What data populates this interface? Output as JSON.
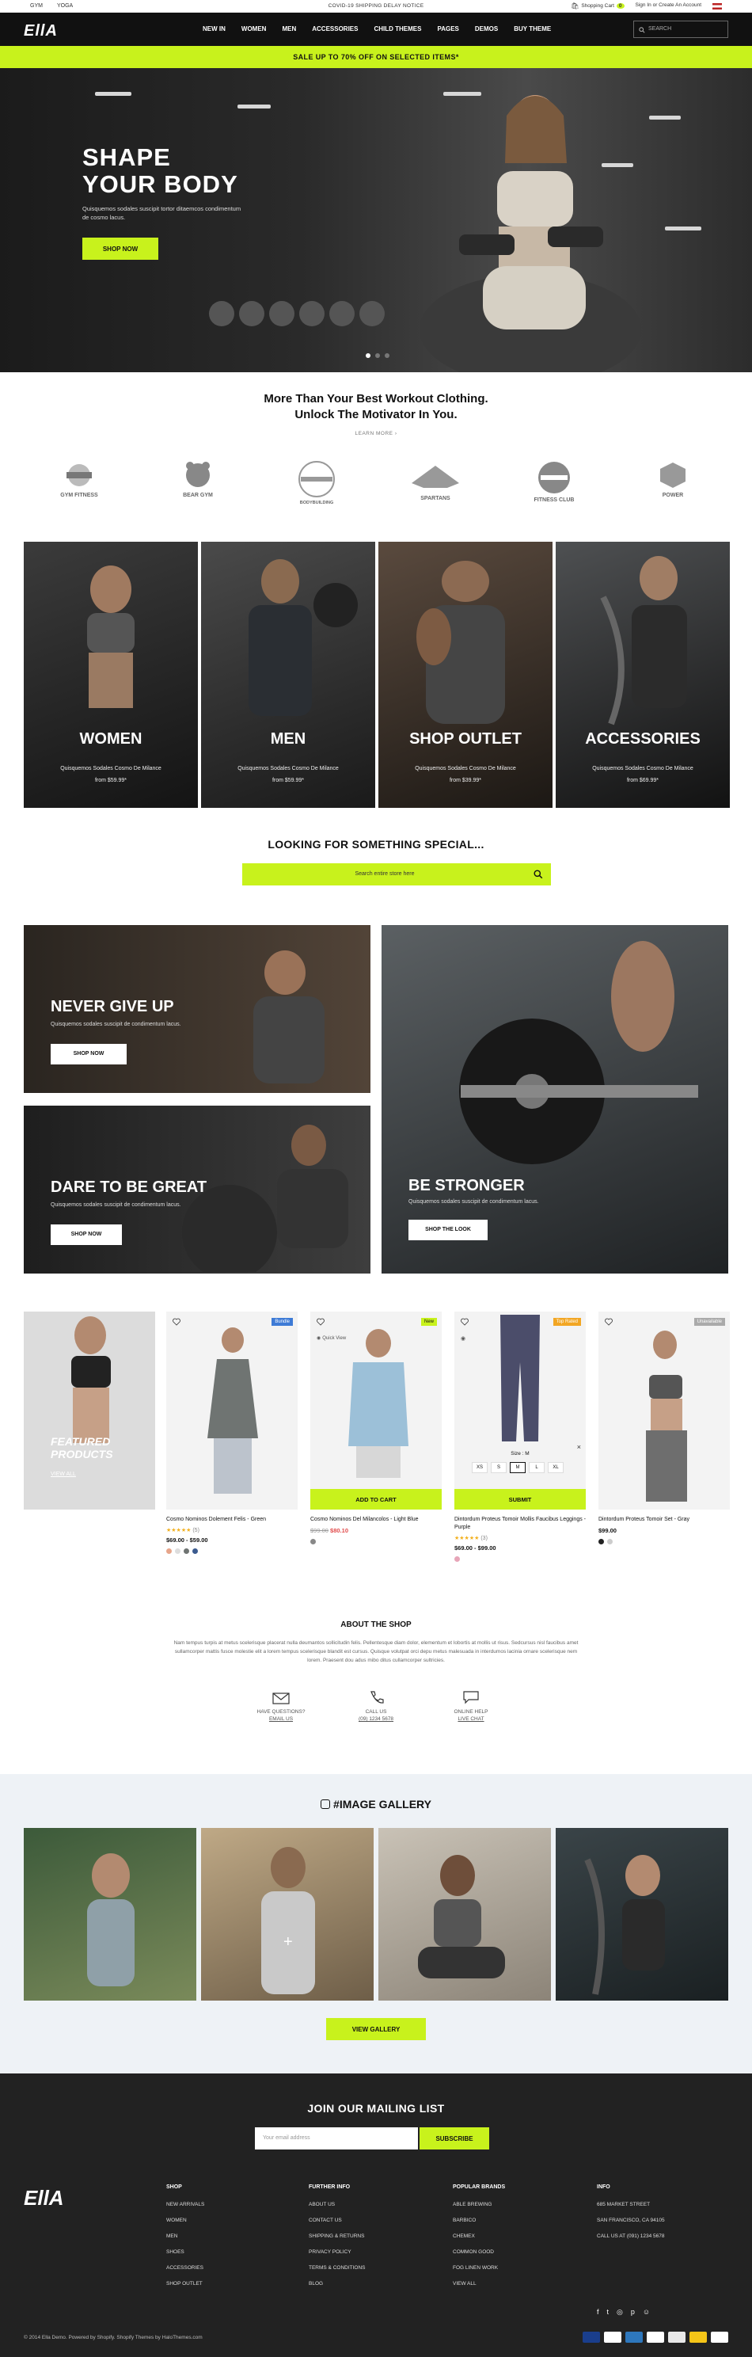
{
  "utility": {
    "links": [
      "GYM",
      "YOGA"
    ],
    "notice": "COVID-19 SHIPPING DELAY NOTICE",
    "cart_label": "Shopping Cart",
    "cart_count": "0",
    "account": "Sign In or Create An Account"
  },
  "header": {
    "logo": "EllA",
    "nav": [
      "NEW IN",
      "WOMEN",
      "MEN",
      "ACCESSORIES",
      "CHILD THEMES",
      "PAGES",
      "DEMOS",
      "BUY THEME"
    ],
    "search_placeholder": "SEARCH"
  },
  "promo": "SALE UP TO 70% OFF ON SELECTED ITEMS*",
  "hero": {
    "title_line1": "SHAPE",
    "title_line2": "YOUR BODY",
    "subtitle": "Quisquemos sodales suscipit tortor ditaemcos condimentum de cosmo lacus.",
    "button": "SHOP NOW"
  },
  "tagline": {
    "line1": "More Than Your Best Workout Clothing.",
    "line2": "Unlock The Motivator In You.",
    "link": "LEARN MORE"
  },
  "brands": [
    "GYM FITNESS",
    "BEAR GYM",
    "BODYBUILDING",
    "SPARTANS",
    "FITNESS CLUB",
    "POWER"
  ],
  "categories": [
    {
      "title": "WOMEN",
      "subtitle": "Quisquemos Sodales Cosmo De Milance",
      "price": "from $59.99*"
    },
    {
      "title": "MEN",
      "subtitle": "Quisquemos Sodales Cosmo De Milance",
      "price": "from $59.99*"
    },
    {
      "title": "SHOP OUTLET",
      "subtitle": "Quisquemos Sodales Cosmo De Milance",
      "price": "from $39.99*"
    },
    {
      "title": "ACCESSORIES",
      "subtitle": "Quisquemos Sodales Cosmo De Milance",
      "price": "from $69.99*"
    }
  ],
  "looking": {
    "title": "LOOKING FOR SOMETHING SPECIAL...",
    "placeholder": "Search entire store here"
  },
  "banners": [
    {
      "title": "NEVER GIVE UP",
      "desc": "Quisquemos sodales suscipit de condimentum lacus.",
      "button": "SHOP NOW"
    },
    {
      "title": "DARE TO BE GREAT",
      "desc": "Quisquemos sodales suscipit de condimentum lacus.",
      "button": "SHOP NOW"
    },
    {
      "title": "BE STRONGER",
      "desc": "Quisquemos sodales suscipit de condimentum lacus.",
      "button": "SHOP THE LOOK"
    }
  ],
  "featured": {
    "title_line1": "FEATURED",
    "title_line2": "PRODUCTS",
    "link": "VIEW ALL"
  },
  "products": [
    {
      "name": "Cosmo Nominos Dolement Felis - Green",
      "price": "$69.00 - $59.00",
      "badge": "Bundle",
      "rating": "★★★★★",
      "reviews": "(5)"
    },
    {
      "name": "Cosmo Nominos Del Milancolos - Light Blue",
      "old_price": "$99.00",
      "price": "$80.10",
      "badge": "New",
      "quick_view": "Quick View",
      "button": "ADD TO CART"
    },
    {
      "name": "Dintordum Proteus Tomoir Mollis Faucibus Leggings - Purple",
      "price": "$69.00 - $99.00",
      "badge": "Top Rated",
      "rating": "★★★★★",
      "reviews": "(3)",
      "size_label": "Size : M",
      "sizes": [
        "XS",
        "S",
        "M",
        "L",
        "XL"
      ],
      "button": "SUBMIT"
    },
    {
      "name": "Dintordum Proteus Tomoir Set - Gray",
      "price": "$99.00",
      "badge": "Unavailable"
    }
  ],
  "about": {
    "title": "ABOUT THE SHOP",
    "text": "Nam tempus turpis at metus scelerisque placerat nulla deumantos sollicitudin felis. Pellentesque diam dolor, elementum et lobortis at mollis ut risus. Sedcursus nisl faucibus amet sullamcorper mattis fusce molestie elit a lorem tempus scelerisque blandit est cursus. Quisque volutpat orci depu metus malesuada in interdumos lacinia ornare scelerisque nem lorem. Praesent dou adus mibo ditus cullamcorper sultricies.",
    "items": [
      {
        "l1": "HAVE QUESTIONS?",
        "l2": "EMAIL US"
      },
      {
        "l1": "CALL US",
        "l2": "(09) 1234 5678"
      },
      {
        "l1": "ONLINE HELP",
        "l2": "LIVE CHAT"
      }
    ]
  },
  "gallery": {
    "title": "#IMAGE GALLERY",
    "button": "VIEW GALLERY"
  },
  "footer": {
    "join": "JOIN OUR MAILING LIST",
    "email_placeholder": "Your email address",
    "subscribe": "SUBSCRIBE",
    "logo": "EllA",
    "shop": {
      "title": "SHOP",
      "items": [
        "NEW ARRIVALS",
        "WOMEN",
        "MEN",
        "SHOES",
        "ACCESSORIES",
        "SHOP OUTLET"
      ]
    },
    "info": {
      "title": "FURTHER INFO",
      "items": [
        "ABOUT US",
        "CONTACT US",
        "SHIPPING & RETURNS",
        "PRIVACY POLICY",
        "TERMS & CONDITIONS",
        "BLOG"
      ]
    },
    "brands": {
      "title": "POPULAR BRANDS",
      "items": [
        "ABLE BREWING",
        "BARBICO",
        "CHEMEX",
        "COMMON GOOD",
        "FOG LINEN WORK",
        "VIEW ALL"
      ]
    },
    "contact": {
      "title": "INFO",
      "items": [
        "685 MARKET STREET",
        "SAN FRANCISCO, CA 94105",
        "CALL US AT (091) 1234 5678"
      ]
    },
    "copyright": "© 2014 Ella Demo. Powered by Shopify. Shopify Themes by HaloThemes.com"
  }
}
